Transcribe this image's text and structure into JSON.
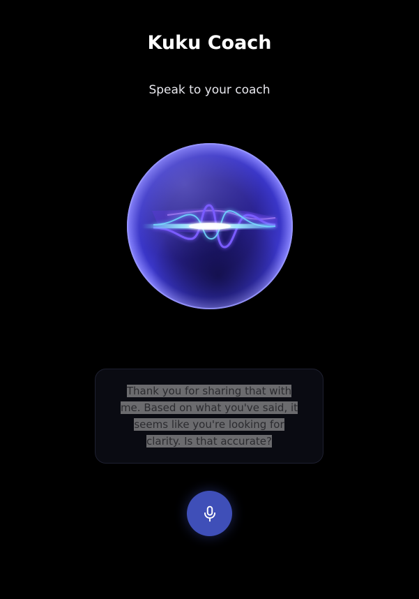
{
  "header": {
    "title": "Kuku Coach",
    "subtitle": "Speak to your coach"
  },
  "orb": {
    "icon": "voice-orb",
    "colors": {
      "core": "#2a1f9e",
      "rim": "#7b7bff",
      "wave_primary": "#a06bff",
      "wave_secondary": "#6fd8ff"
    }
  },
  "message": {
    "text": "Thank you for sharing that with me. Based on what you've said, it seems like you're looking for clarity. Is that accurate?"
  },
  "controls": {
    "mic_icon": "microphone-icon",
    "mic_color": "#3f4fb8"
  }
}
